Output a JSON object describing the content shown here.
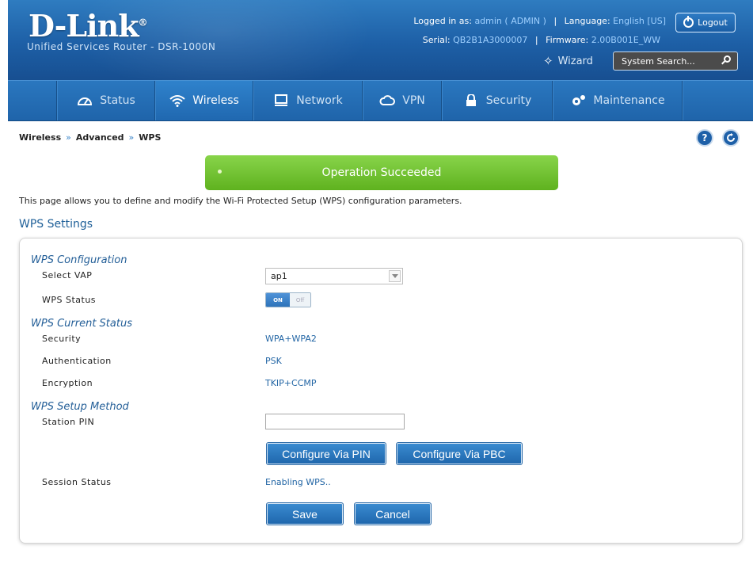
{
  "header": {
    "logo": "D-Link",
    "logo_mark": "®",
    "subtitle": "Unified Services Router - DSR-1000N",
    "logged_in_label": "Logged in as:",
    "logged_in_user": "admin ( ADMIN )",
    "language_label": "Language:",
    "language_value": "English [US]",
    "serial_label": "Serial:",
    "serial_value": "QB2B1A3000007",
    "firmware_label": "Firmware:",
    "firmware_value": "2.00B001E_WW",
    "logout": "Logout",
    "wizard": "Wizard",
    "search_placeholder": "System Search..."
  },
  "nav": [
    {
      "label": "Status",
      "icon": "gauge-icon"
    },
    {
      "label": "Wireless",
      "icon": "wifi-icon",
      "active": true
    },
    {
      "label": "Network",
      "icon": "monitor-icon"
    },
    {
      "label": "VPN",
      "icon": "cloud-icon"
    },
    {
      "label": "Security",
      "icon": "lock-icon"
    },
    {
      "label": "Maintenance",
      "icon": "gears-icon"
    }
  ],
  "breadcrumb": [
    "Wireless",
    "Advanced",
    "WPS"
  ],
  "breadcrumb_sep": "»",
  "help": "?",
  "message": "Operation Succeeded",
  "intro": "This page allows you to define and modify the Wi-Fi Protected Setup (WPS) configuration parameters.",
  "section_title": "WPS Settings",
  "form": {
    "config_title": "WPS Configuration",
    "select_vap_label": "Select VAP",
    "select_vap_value": "ap1",
    "wps_status_label": "WPS Status",
    "toggle_on": "ON",
    "toggle_off": "Off",
    "toggle_state": true,
    "current_status_title": "WPS Current Status",
    "security_label": "Security",
    "security_value": "WPA+WPA2",
    "auth_label": "Authentication",
    "auth_value": "PSK",
    "encryption_label": "Encryption",
    "encryption_value": "TKIP+CCMP",
    "setup_method_title": "WPS Setup Method",
    "station_pin_label": "Station PIN",
    "station_pin_value": "",
    "configure_pin": "Configure Via PIN",
    "configure_pbc": "Configure Via PBC",
    "session_status_label": "Session Status",
    "session_status_value": "Enabling WPS..",
    "save": "Save",
    "cancel": "Cancel"
  },
  "colors": {
    "header_blue": "#1d5fa6",
    "success_green": "#5fb21f",
    "link_blue": "#2366a5"
  }
}
